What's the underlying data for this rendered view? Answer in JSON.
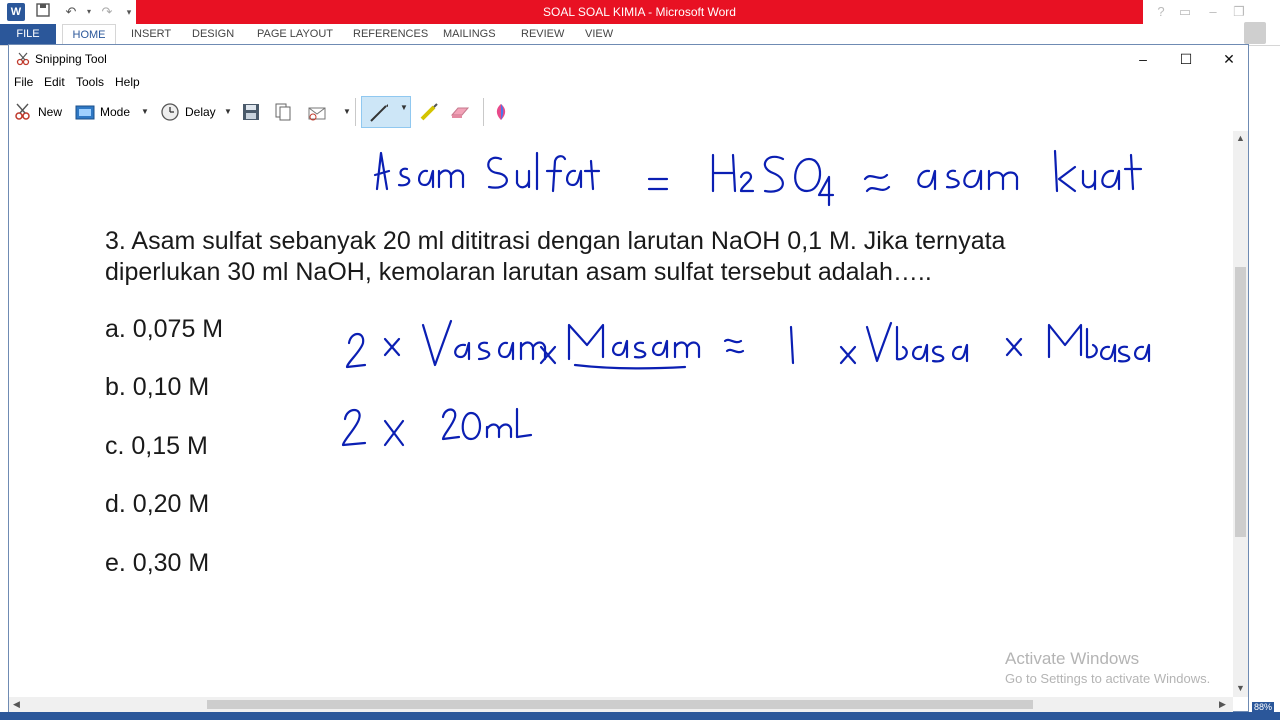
{
  "word": {
    "title": "SOAL SOAL KIMIA - Microsoft Word",
    "tabs": [
      "FILE",
      "HOME",
      "INSERT",
      "DESIGN",
      "PAGE LAYOUT",
      "REFERENCES",
      "MAILINGS",
      "REVIEW",
      "VIEW"
    ],
    "zoom": "88%"
  },
  "snip": {
    "title": "Snipping Tool",
    "menu": [
      "File",
      "Edit",
      "Tools",
      "Help"
    ],
    "toolbar": {
      "new": "New",
      "mode": "Mode",
      "delay": "Delay"
    }
  },
  "doc": {
    "question_line1": "3. Asam sulfat sebanyak 20 ml dititrasi dengan larutan NaOH 0,1 M. Jika ternyata",
    "question_line2": "diperlukan 30 ml NaOH, kemolaran larutan asam sulfat tersebut adalah…..",
    "options": [
      "a. 0,075 M",
      "b. 0,10 M",
      "c. 0,15 M",
      "d. 0,20 M",
      "e. 0,30 M"
    ]
  },
  "handwriting": {
    "line1": "Asam Sulfat = H₂SO₄ ≃ asam kuat",
    "line2": "2 x Vasam x Masam ≈ 1 x Vbasa x Mbasa",
    "line3": "2 x 20 mL",
    "color": "#0b1fb3"
  },
  "watermark": {
    "title": "Activate Windows",
    "subtitle": "Go to Settings to activate Windows."
  }
}
